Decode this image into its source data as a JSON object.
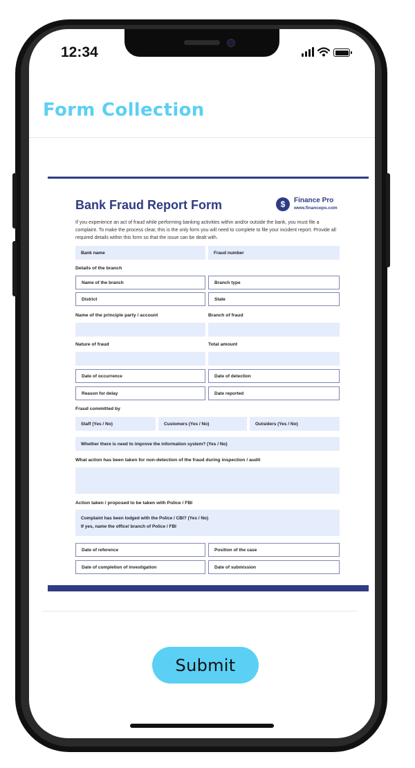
{
  "status_bar": {
    "time": "12:34"
  },
  "app": {
    "title": "Form Collection",
    "submit_label": "Submit"
  },
  "form": {
    "title": "Bank Fraud Report Form",
    "brand": {
      "name": "Finance Pro",
      "url": "www.financepo.com",
      "logo_glyph": "$"
    },
    "intro": "If you experience an act of fraud while performing banking activities within and/or outside the bank, you must file a complaint. To make the process clear, this is the only form you will need to complete to file your incident report. Provide all required details within this form so that the issue can be dealt with.",
    "fields": {
      "bank_name": "Bank name",
      "fraud_number": "Fraud number",
      "details_branch": "Details of the branch",
      "branch_name": "Name of the branch",
      "branch_type": "Branch type",
      "district": "District",
      "state": "State",
      "principle_party": "Name of the principle party / account",
      "branch_of_fraud": "Branch of fraud",
      "nature_of_fraud": "Nature of fraud",
      "total_amount": "Total amount",
      "date_occurrence": "Date of occurrence",
      "date_detection": "Date of detection",
      "reason_delay": "Reason for delay",
      "date_reported": "Date reported",
      "fraud_committed_by": "Fraud committed by",
      "staff": "Staff (Yes / No)",
      "customers": "Customers (Yes / No)",
      "outsiders": "Outsiders (Yes / No)",
      "improve_info": "Whether there is need to improve the information system? (Yes / No)",
      "action_non_detection": "What action has been taken for non-detection of the fraud during inspection / audit",
      "action_police": "Action taken / proposed to be taken with Police / FBI",
      "complaint_lodged": "Complaint has been lodged with the Police / CBI? (Yes / No)",
      "office_branch": "If yes, name the office/ branch of Police / FBI",
      "date_reference": "Date of reference",
      "position_case": "Position of the case",
      "date_completion": "Date of completion of investigation",
      "date_submission": "Date of submission"
    }
  },
  "colors": {
    "accent": "#5bd0f4",
    "form_navy": "#2e3c84",
    "field_shade": "#e5ecfb"
  }
}
